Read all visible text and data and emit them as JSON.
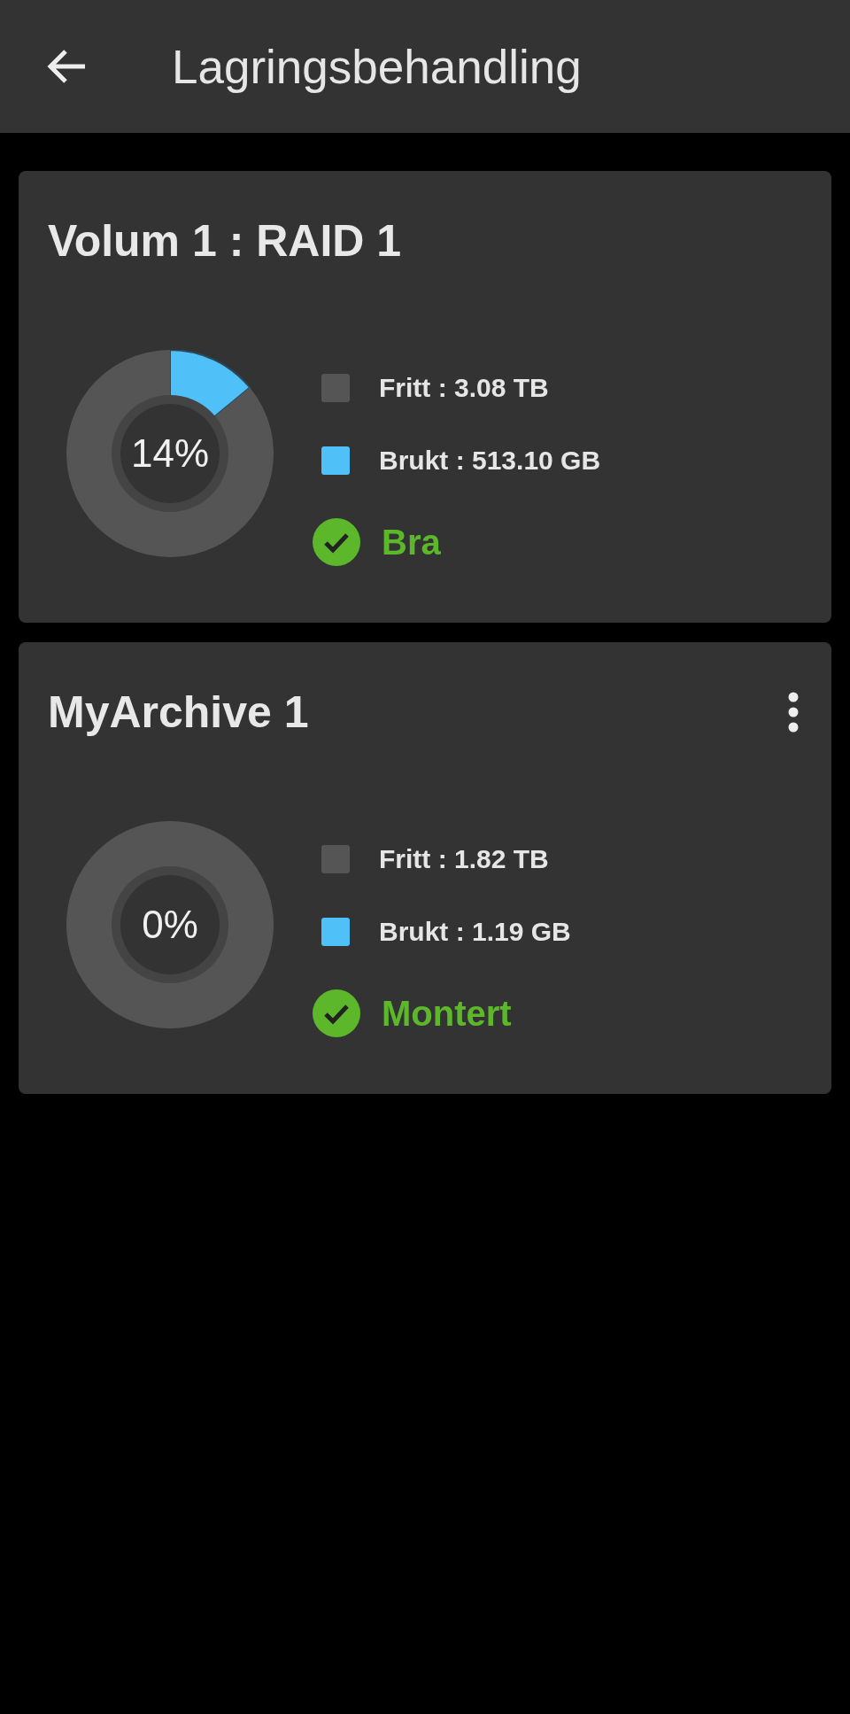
{
  "header": {
    "title": "Lagringsbehandling"
  },
  "volumes": [
    {
      "title": "Volum 1 : RAID 1",
      "menu": false,
      "chart_data": {
        "type": "donut",
        "values": [
          86,
          14
        ]
      },
      "percent": "14%",
      "free": "Fritt : 3.08 TB",
      "used": "Brukt : 513.10 GB",
      "status": {
        "kind": "ok",
        "label": "Bra"
      }
    },
    {
      "title": "MyArchive 1",
      "menu": true,
      "chart_data": {
        "type": "donut",
        "values": [
          100,
          0
        ]
      },
      "percent": "0%",
      "free": "Fritt : 1.82 TB",
      "used": "Brukt : 1.19 GB",
      "status": {
        "kind": "ok",
        "label": "Montert"
      }
    }
  ]
}
